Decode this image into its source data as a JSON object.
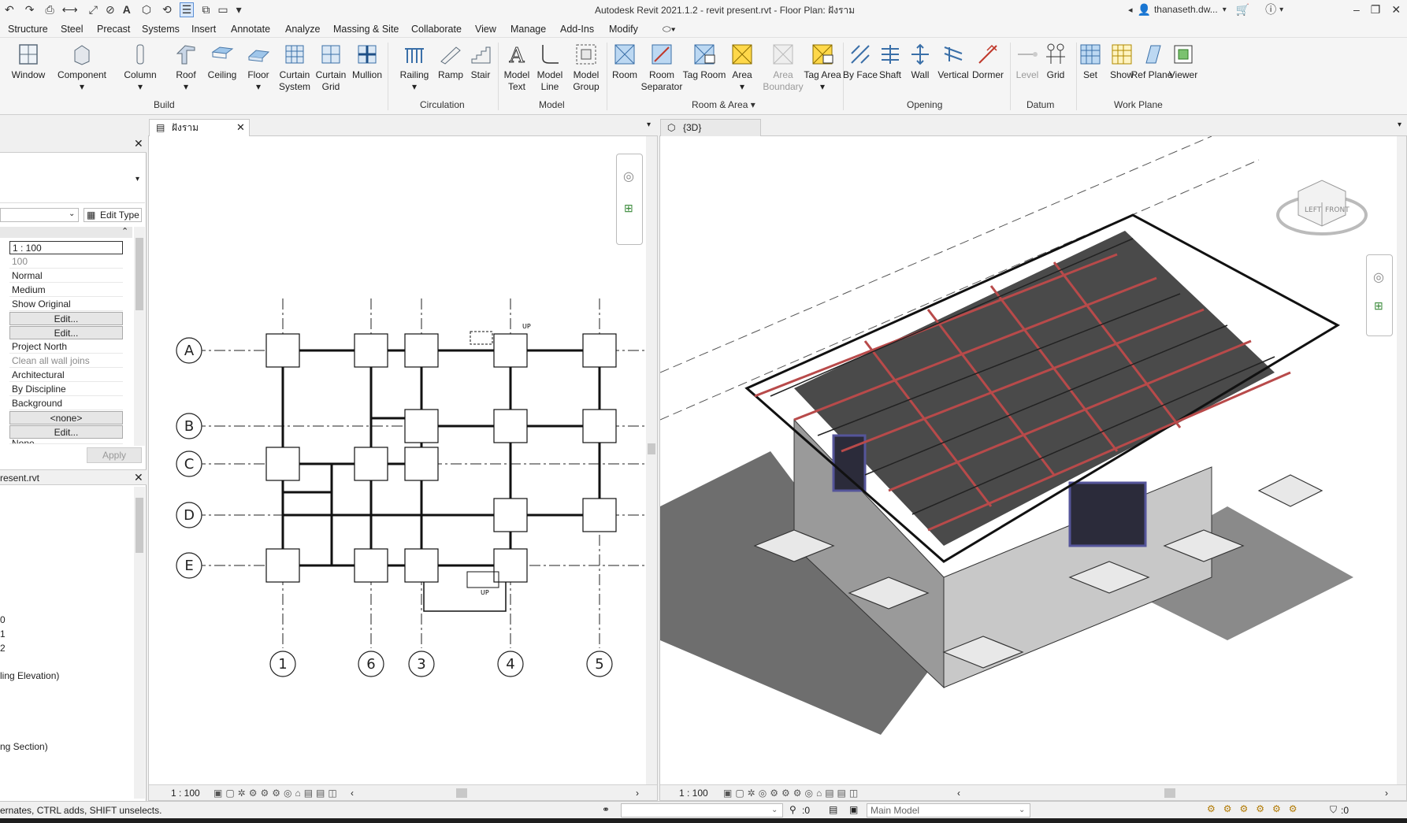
{
  "window": {
    "title": "Autodesk Revit 2021.1.2 - revit present.rvt - Floor Plan: ฝังราม",
    "user": "thanaseth.dw..."
  },
  "menu": [
    "Structure",
    "Steel",
    "Precast",
    "Systems",
    "Insert",
    "Annotate",
    "Analyze",
    "Massing & Site",
    "Collaborate",
    "View",
    "Manage",
    "Add-Ins",
    "Modify"
  ],
  "ribbon": {
    "buttons": [
      {
        "label": "Window",
        "icon": "window-icon"
      },
      {
        "label": "Component",
        "icon": "component-icon"
      },
      {
        "label": "Column",
        "icon": "column-icon"
      },
      {
        "label": "Roof",
        "icon": "roof-icon"
      },
      {
        "label": "Ceiling",
        "icon": "ceiling-icon"
      },
      {
        "label": "Floor",
        "icon": "floor-icon"
      },
      {
        "label": "Curtain System",
        "icon": "curtain-system-icon"
      },
      {
        "label": "Curtain Grid",
        "icon": "curtain-grid-icon"
      },
      {
        "label": "Mullion",
        "icon": "mullion-icon"
      },
      {
        "label": "Railing",
        "icon": "railing-icon"
      },
      {
        "label": "Ramp",
        "icon": "ramp-icon"
      },
      {
        "label": "Stair",
        "icon": "stair-icon"
      },
      {
        "label": "Model Text",
        "icon": "model-text-icon"
      },
      {
        "label": "Model Line",
        "icon": "model-line-icon"
      },
      {
        "label": "Model Group",
        "icon": "model-group-icon"
      },
      {
        "label": "Room",
        "icon": "room-icon"
      },
      {
        "label": "Room Separator",
        "icon": "room-separator-icon"
      },
      {
        "label": "Tag Room",
        "icon": "tag-room-icon"
      },
      {
        "label": "Area",
        "icon": "area-icon"
      },
      {
        "label": "Area Boundary",
        "icon": "area-boundary-icon"
      },
      {
        "label": "Tag Area",
        "icon": "tag-area-icon"
      },
      {
        "label": "By Face",
        "icon": "by-face-icon"
      },
      {
        "label": "Shaft",
        "icon": "shaft-icon"
      },
      {
        "label": "Wall",
        "icon": "wall-opening-icon"
      },
      {
        "label": "Vertical",
        "icon": "vertical-icon"
      },
      {
        "label": "Dormer",
        "icon": "dormer-icon"
      },
      {
        "label": "Level",
        "icon": "level-icon"
      },
      {
        "label": "Grid",
        "icon": "grid-icon"
      },
      {
        "label": "Set",
        "icon": "set-icon"
      },
      {
        "label": "Show",
        "icon": "show-icon"
      },
      {
        "label": "Ref Plane",
        "icon": "ref-plane-icon"
      },
      {
        "label": "Viewer",
        "icon": "viewer-icon"
      }
    ],
    "panels": [
      "Build",
      "Circulation",
      "Model",
      "Room & Area",
      "Opening",
      "Datum",
      "Work Plane"
    ]
  },
  "properties": {
    "edit_type": "Edit Type",
    "rows": [
      "1 : 100",
      "100",
      "Normal",
      "Medium",
      "Show Original",
      "Edit...",
      "Edit...",
      "Project North",
      "Clean all wall joins",
      "Architectural",
      "By Discipline",
      "Background",
      "<none>",
      "Edit...",
      "None"
    ],
    "apply": "Apply"
  },
  "browser": {
    "title": "resent.rvt",
    "items": [
      "0",
      "1",
      "2",
      "ling Elevation)",
      "ng Section)"
    ]
  },
  "views": {
    "plan_tab": "ฝังราม",
    "view3d_tab": "{3D}",
    "plan_scale": "1 : 100",
    "view3d_scale": "1 : 100",
    "grid_rows": [
      "A",
      "B",
      "C",
      "D",
      "E"
    ],
    "grid_cols": [
      "1",
      "6",
      "3",
      "4",
      "5"
    ],
    "viewcube_left": "LEFT",
    "viewcube_front": "FRONT",
    "up_label": "UP"
  },
  "status": {
    "hint": "ernates, CTRL adds, SHIFT unselects.",
    "workset_count": ":0",
    "design_option": "Main Model",
    "filter_count": ":0"
  }
}
